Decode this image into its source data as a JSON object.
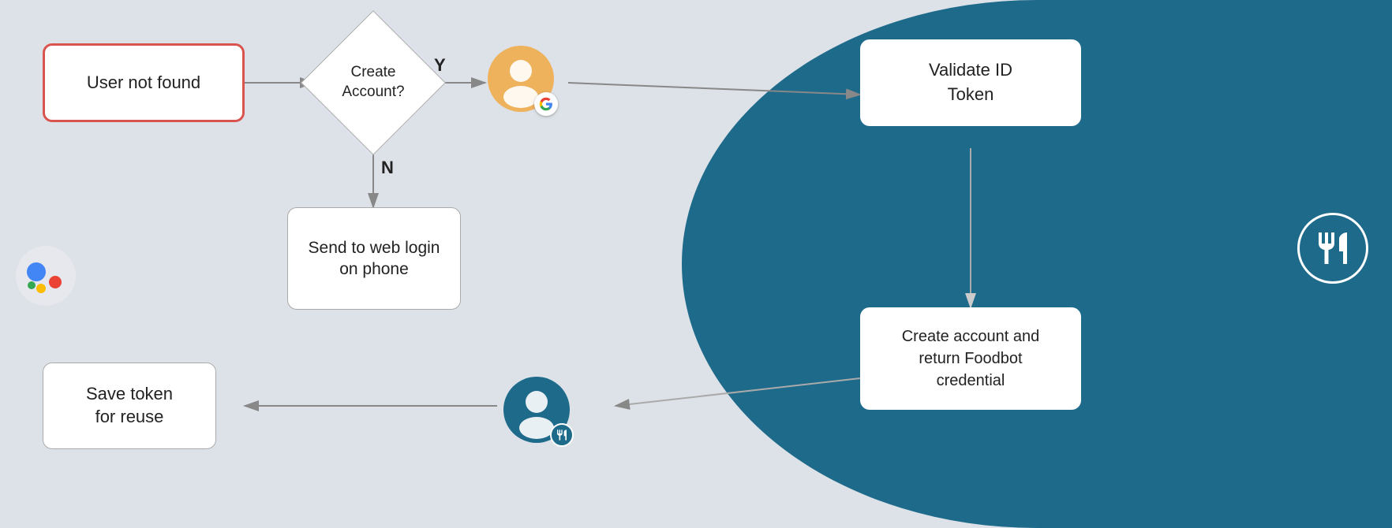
{
  "nodes": {
    "user_not_found": "User not found",
    "create_account": "Create\nAccount?",
    "send_to_web": "Send to web login\non phone",
    "save_token": "Save token\nfor reuse",
    "validate_id": "Validate ID\nToken",
    "create_account_return": "Create account and\nreturn Foodbot\ncredential"
  },
  "labels": {
    "y": "Y",
    "n": "N"
  },
  "colors": {
    "bg_left": "#dde2e8",
    "bg_right": "#1e6a8a",
    "red_border": "#d9534f",
    "white": "#ffffff",
    "dark_text": "#222222"
  }
}
